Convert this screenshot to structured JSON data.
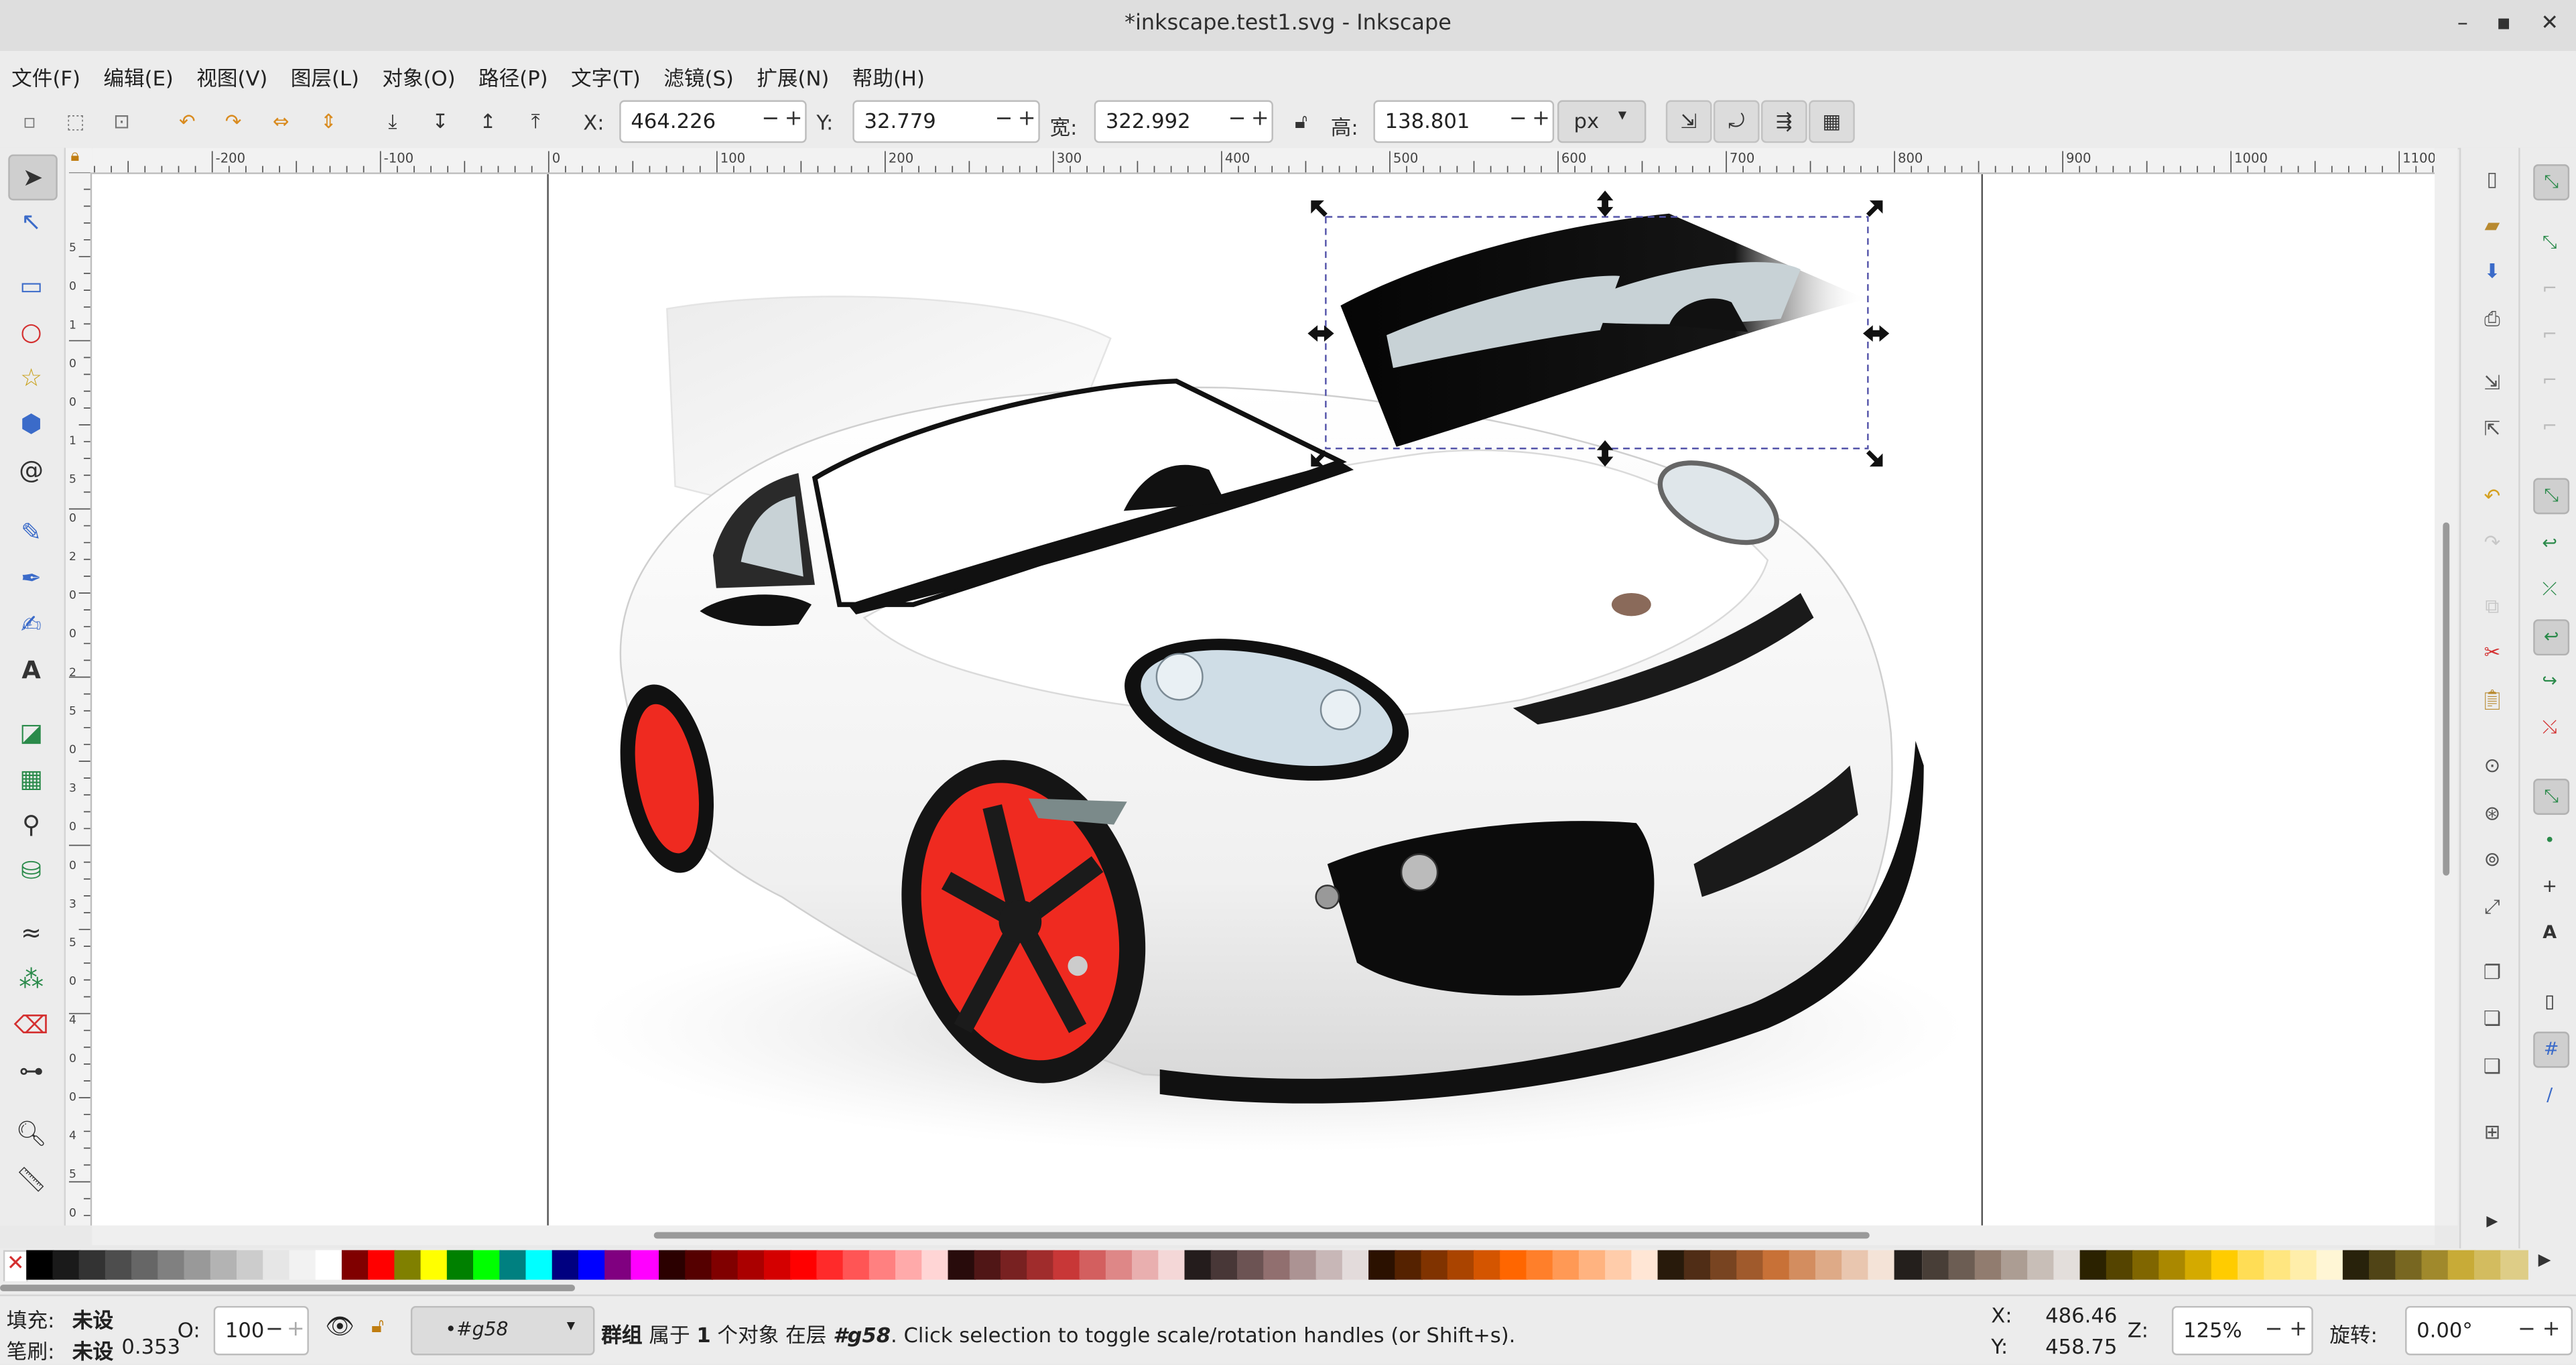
{
  "window": {
    "title": "*inkscape.test1.svg - Inkscape"
  },
  "menu": [
    "文件(F)",
    "编辑(E)",
    "视图(V)",
    "图层(L)",
    "对象(O)",
    "路径(P)",
    "文字(T)",
    "滤镜(S)",
    "扩展(N)",
    "帮助(H)"
  ],
  "toolbar": {
    "x_label": "X:",
    "x_value": "464.226",
    "y_label": "Y:",
    "y_value": "32.779",
    "w_label": "宽:",
    "w_value": "322.992",
    "h_label": "高:",
    "h_value": "138.801",
    "unit": "px",
    "minus": "−",
    "plus": "+"
  },
  "ruler_h": [
    "-200",
    "-100",
    "0",
    "100",
    "200",
    "300",
    "400",
    "500",
    "600",
    "700",
    "800",
    "900",
    "1000",
    "1100"
  ],
  "ruler_v": [
    "5",
    "0",
    "1",
    "0",
    "0",
    "1",
    "5",
    "0",
    "2",
    "0",
    "0",
    "2",
    "5",
    "0",
    "3",
    "0",
    "0",
    "3",
    "5",
    "0",
    "4",
    "0",
    "0",
    "4",
    "5",
    "0",
    "5"
  ],
  "palette_colors": [
    "#000000",
    "#1a1a1a",
    "#333333",
    "#4d4d4d",
    "#666666",
    "#808080",
    "#999999",
    "#b3b3b3",
    "#cccccc",
    "#e6e6e6",
    "#f2f2f2",
    "#ffffff",
    "#800000",
    "#ff0000",
    "#808000",
    "#ffff00",
    "#008000",
    "#00ff00",
    "#008080",
    "#00ffff",
    "#000080",
    "#0000ff",
    "#800080",
    "#ff00ff",
    "#2b0000",
    "#550000",
    "#800000",
    "#aa0000",
    "#d40000",
    "#ff0000",
    "#ff2a2a",
    "#ff5555",
    "#ff8080",
    "#ffaaaa",
    "#ffd5d5",
    "#280b0b",
    "#501616",
    "#782121",
    "#a02c2c",
    "#c83737",
    "#d35f5f",
    "#de8787",
    "#e9afaf",
    "#f4d7d7",
    "#241c1c",
    "#483737",
    "#6c5353",
    "#916f6f",
    "#ac9393",
    "#c8b7b7",
    "#e3dbdb",
    "#2b1100",
    "#552200",
    "#803300",
    "#aa4400",
    "#d45500",
    "#ff6600",
    "#ff7f2a",
    "#ff9955",
    "#ffb380",
    "#ffccaa",
    "#ffe6d5",
    "#281a0b",
    "#502d16",
    "#784421",
    "#a05a2c",
    "#c87137",
    "#d38d5f",
    "#deaa87",
    "#e9c6af",
    "#f4e3d7",
    "#241f1c",
    "#483e37",
    "#6c5d53",
    "#917c6f",
    "#ac9d93",
    "#c8beb7",
    "#e3dedb",
    "#2b2200",
    "#554400",
    "#806600",
    "#aa8800",
    "#d4aa00",
    "#ffcc00",
    "#ffdd55",
    "#ffe680",
    "#ffeeaa",
    "#fff6d5",
    "#28220b",
    "#504416",
    "#786721",
    "#a0892c",
    "#c8ab37",
    "#d3bc5f",
    "#decd87"
  ],
  "status": {
    "fill_label": "填充:",
    "fill_value": "未设",
    "stroke_label": "笔刷:",
    "stroke_value": "未设",
    "stroke_width": "0.353",
    "opacity_label": "O:",
    "opacity_value": "100",
    "layer_value": "•#g58",
    "message_prefix": "群组",
    "message_mid1": " 属于 ",
    "message_count": "1",
    "message_mid2": " 个对象 在层 ",
    "message_layer": "#g58",
    "message_suffix": ". Click selection to toggle scale/rotation handles (or Shift+s).",
    "x_label": "X:",
    "x_value": "486.46",
    "y_label": "Y:",
    "y_value": "458.75",
    "zoom_label": "Z:",
    "zoom_value": "125%",
    "rotate_label": "旋转:",
    "rotate_value": "0.00°"
  },
  "colors": {
    "accent": "#3b6bc9",
    "wheel_red": "#ef2a20",
    "selection": "#5555aa"
  }
}
